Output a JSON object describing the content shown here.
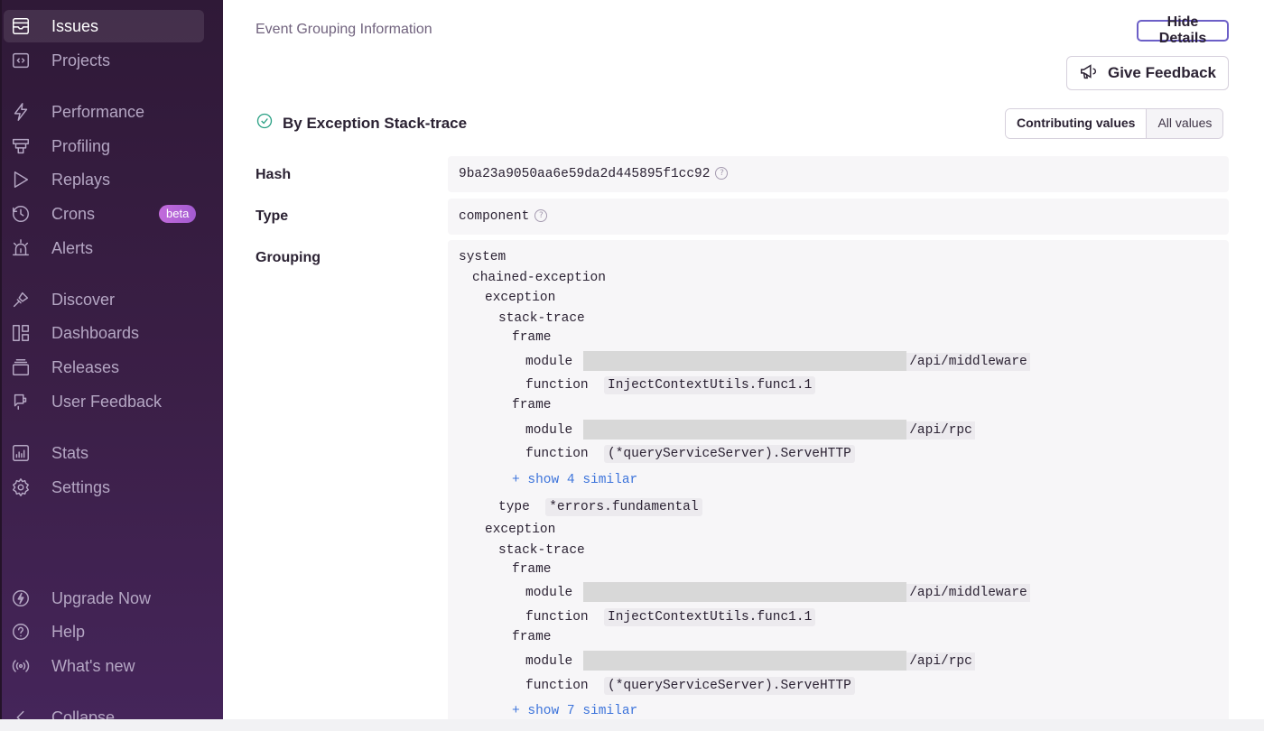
{
  "sidebar": {
    "items": [
      {
        "label": "Issues",
        "icon": "issues-icon",
        "active": true
      },
      {
        "label": "Projects",
        "icon": "projects-icon"
      },
      {
        "label": "Performance",
        "icon": "performance-icon"
      },
      {
        "label": "Profiling",
        "icon": "profiling-icon"
      },
      {
        "label": "Replays",
        "icon": "replays-icon"
      },
      {
        "label": "Crons",
        "icon": "crons-icon",
        "badge": "beta"
      },
      {
        "label": "Alerts",
        "icon": "alerts-icon"
      },
      {
        "label": "Discover",
        "icon": "discover-icon"
      },
      {
        "label": "Dashboards",
        "icon": "dashboards-icon"
      },
      {
        "label": "Releases",
        "icon": "releases-icon"
      },
      {
        "label": "User Feedback",
        "icon": "user-feedback-icon"
      },
      {
        "label": "Stats",
        "icon": "stats-icon"
      },
      {
        "label": "Settings",
        "icon": "settings-icon"
      }
    ],
    "footer": [
      {
        "label": "Upgrade Now",
        "icon": "upgrade-icon"
      },
      {
        "label": "Help",
        "icon": "help-icon"
      },
      {
        "label": "What's new",
        "icon": "broadcast-icon"
      },
      {
        "label": "Collapse",
        "icon": "collapse-icon"
      }
    ]
  },
  "main": {
    "section_title": "Event Grouping Information",
    "hide_details": "Hide Details",
    "give_feedback": "Give Feedback",
    "variant_title": "By Exception Stack-trace",
    "toggle": {
      "contributing": "Contributing values",
      "all": "All values"
    },
    "hash": {
      "label": "Hash",
      "value": "9ba23a9050aa6e59da2d445895f1cc92"
    },
    "type": {
      "label": "Type",
      "value": "component"
    },
    "grouping": {
      "label": "Grouping",
      "system": "system",
      "chained": "chained-exception",
      "exception": "exception",
      "stack_trace": "stack-trace",
      "frame": "frame",
      "module": "module",
      "function": "function",
      "type_key": "type",
      "ex1": {
        "f1_module": "/api/middleware",
        "f1_function": "InjectContextUtils.func1.1",
        "f2_module": "/api/rpc",
        "f2_function": "(*queryServiceServer).ServeHTTP",
        "show_similar": "+ show 4 similar",
        "type_value": "*errors.fundamental"
      },
      "ex2": {
        "f1_module": "/api/middleware",
        "f1_function": "InjectContextUtils.func1.1",
        "f2_module": "/api/rpc",
        "f2_function": "(*queryServiceServer).ServeHTTP",
        "show_similar": "+ show 7 similar"
      }
    }
  }
}
